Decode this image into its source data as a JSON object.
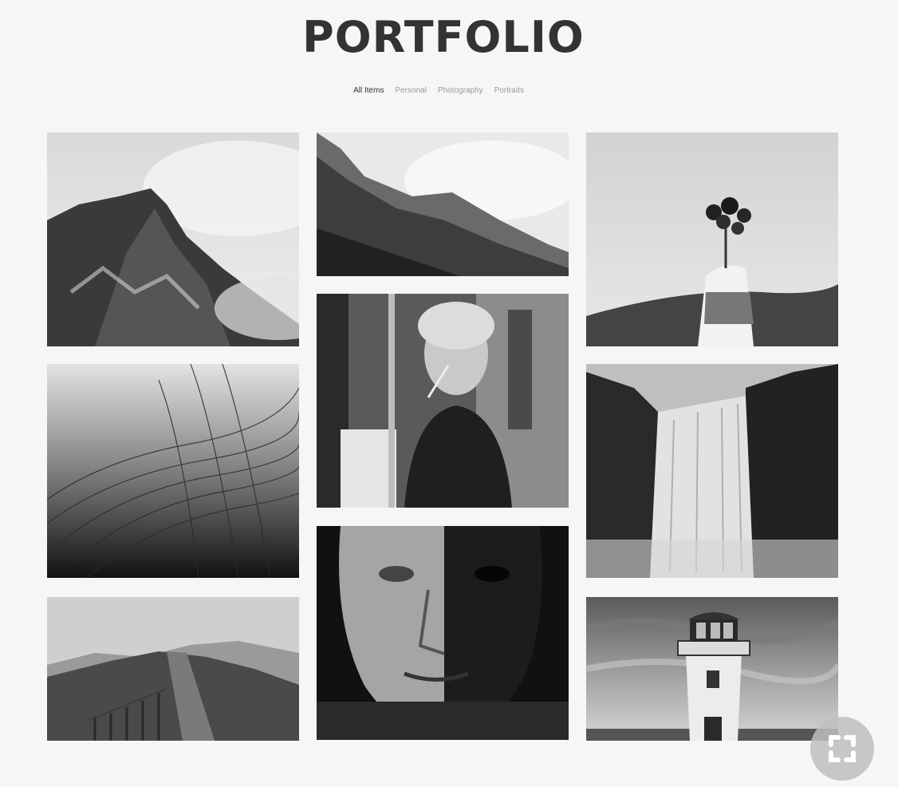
{
  "header": {
    "title": "PORTFOLIO"
  },
  "filters": [
    {
      "label": "All Items",
      "active": true
    },
    {
      "label": "Personal",
      "active": false
    },
    {
      "label": "Photography",
      "active": false
    },
    {
      "label": "Portraits",
      "active": false
    }
  ],
  "gallery": {
    "items": [
      {
        "subject": "mountain-peak-in-clouds"
      },
      {
        "subject": "forested-mountain-ridge"
      },
      {
        "subject": "hand-holding-flowers"
      },
      {
        "subject": "grass-blades-in-fog"
      },
      {
        "subject": "woman-applying-makeup-in-mirror"
      },
      {
        "subject": "waterfall"
      },
      {
        "subject": "hillside-path-with-fence"
      },
      {
        "subject": "portrait-of-older-man"
      },
      {
        "subject": "lighthouse"
      }
    ]
  },
  "fab": {
    "icon": "fullscreen-expand-icon"
  }
}
